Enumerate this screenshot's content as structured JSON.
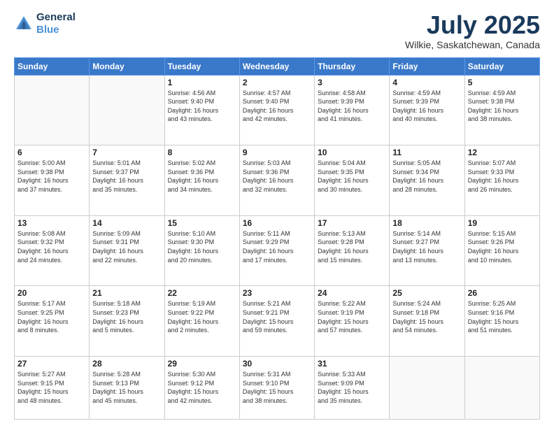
{
  "logo": {
    "line1": "General",
    "line2": "Blue"
  },
  "title": "July 2025",
  "subtitle": "Wilkie, Saskatchewan, Canada",
  "days_header": [
    "Sunday",
    "Monday",
    "Tuesday",
    "Wednesday",
    "Thursday",
    "Friday",
    "Saturday"
  ],
  "weeks": [
    [
      {
        "day": "",
        "info": ""
      },
      {
        "day": "",
        "info": ""
      },
      {
        "day": "1",
        "info": "Sunrise: 4:56 AM\nSunset: 9:40 PM\nDaylight: 16 hours\nand 43 minutes."
      },
      {
        "day": "2",
        "info": "Sunrise: 4:57 AM\nSunset: 9:40 PM\nDaylight: 16 hours\nand 42 minutes."
      },
      {
        "day": "3",
        "info": "Sunrise: 4:58 AM\nSunset: 9:39 PM\nDaylight: 16 hours\nand 41 minutes."
      },
      {
        "day": "4",
        "info": "Sunrise: 4:59 AM\nSunset: 9:39 PM\nDaylight: 16 hours\nand 40 minutes."
      },
      {
        "day": "5",
        "info": "Sunrise: 4:59 AM\nSunset: 9:38 PM\nDaylight: 16 hours\nand 38 minutes."
      }
    ],
    [
      {
        "day": "6",
        "info": "Sunrise: 5:00 AM\nSunset: 9:38 PM\nDaylight: 16 hours\nand 37 minutes."
      },
      {
        "day": "7",
        "info": "Sunrise: 5:01 AM\nSunset: 9:37 PM\nDaylight: 16 hours\nand 35 minutes."
      },
      {
        "day": "8",
        "info": "Sunrise: 5:02 AM\nSunset: 9:36 PM\nDaylight: 16 hours\nand 34 minutes."
      },
      {
        "day": "9",
        "info": "Sunrise: 5:03 AM\nSunset: 9:36 PM\nDaylight: 16 hours\nand 32 minutes."
      },
      {
        "day": "10",
        "info": "Sunrise: 5:04 AM\nSunset: 9:35 PM\nDaylight: 16 hours\nand 30 minutes."
      },
      {
        "day": "11",
        "info": "Sunrise: 5:05 AM\nSunset: 9:34 PM\nDaylight: 16 hours\nand 28 minutes."
      },
      {
        "day": "12",
        "info": "Sunrise: 5:07 AM\nSunset: 9:33 PM\nDaylight: 16 hours\nand 26 minutes."
      }
    ],
    [
      {
        "day": "13",
        "info": "Sunrise: 5:08 AM\nSunset: 9:32 PM\nDaylight: 16 hours\nand 24 minutes."
      },
      {
        "day": "14",
        "info": "Sunrise: 5:09 AM\nSunset: 9:31 PM\nDaylight: 16 hours\nand 22 minutes."
      },
      {
        "day": "15",
        "info": "Sunrise: 5:10 AM\nSunset: 9:30 PM\nDaylight: 16 hours\nand 20 minutes."
      },
      {
        "day": "16",
        "info": "Sunrise: 5:11 AM\nSunset: 9:29 PM\nDaylight: 16 hours\nand 17 minutes."
      },
      {
        "day": "17",
        "info": "Sunrise: 5:13 AM\nSunset: 9:28 PM\nDaylight: 16 hours\nand 15 minutes."
      },
      {
        "day": "18",
        "info": "Sunrise: 5:14 AM\nSunset: 9:27 PM\nDaylight: 16 hours\nand 13 minutes."
      },
      {
        "day": "19",
        "info": "Sunrise: 5:15 AM\nSunset: 9:26 PM\nDaylight: 16 hours\nand 10 minutes."
      }
    ],
    [
      {
        "day": "20",
        "info": "Sunrise: 5:17 AM\nSunset: 9:25 PM\nDaylight: 16 hours\nand 8 minutes."
      },
      {
        "day": "21",
        "info": "Sunrise: 5:18 AM\nSunset: 9:23 PM\nDaylight: 16 hours\nand 5 minutes."
      },
      {
        "day": "22",
        "info": "Sunrise: 5:19 AM\nSunset: 9:22 PM\nDaylight: 16 hours\nand 2 minutes."
      },
      {
        "day": "23",
        "info": "Sunrise: 5:21 AM\nSunset: 9:21 PM\nDaylight: 15 hours\nand 59 minutes."
      },
      {
        "day": "24",
        "info": "Sunrise: 5:22 AM\nSunset: 9:19 PM\nDaylight: 15 hours\nand 57 minutes."
      },
      {
        "day": "25",
        "info": "Sunrise: 5:24 AM\nSunset: 9:18 PM\nDaylight: 15 hours\nand 54 minutes."
      },
      {
        "day": "26",
        "info": "Sunrise: 5:25 AM\nSunset: 9:16 PM\nDaylight: 15 hours\nand 51 minutes."
      }
    ],
    [
      {
        "day": "27",
        "info": "Sunrise: 5:27 AM\nSunset: 9:15 PM\nDaylight: 15 hours\nand 48 minutes."
      },
      {
        "day": "28",
        "info": "Sunrise: 5:28 AM\nSunset: 9:13 PM\nDaylight: 15 hours\nand 45 minutes."
      },
      {
        "day": "29",
        "info": "Sunrise: 5:30 AM\nSunset: 9:12 PM\nDaylight: 15 hours\nand 42 minutes."
      },
      {
        "day": "30",
        "info": "Sunrise: 5:31 AM\nSunset: 9:10 PM\nDaylight: 15 hours\nand 38 minutes."
      },
      {
        "day": "31",
        "info": "Sunrise: 5:33 AM\nSunset: 9:09 PM\nDaylight: 15 hours\nand 35 minutes."
      },
      {
        "day": "",
        "info": ""
      },
      {
        "day": "",
        "info": ""
      }
    ]
  ]
}
